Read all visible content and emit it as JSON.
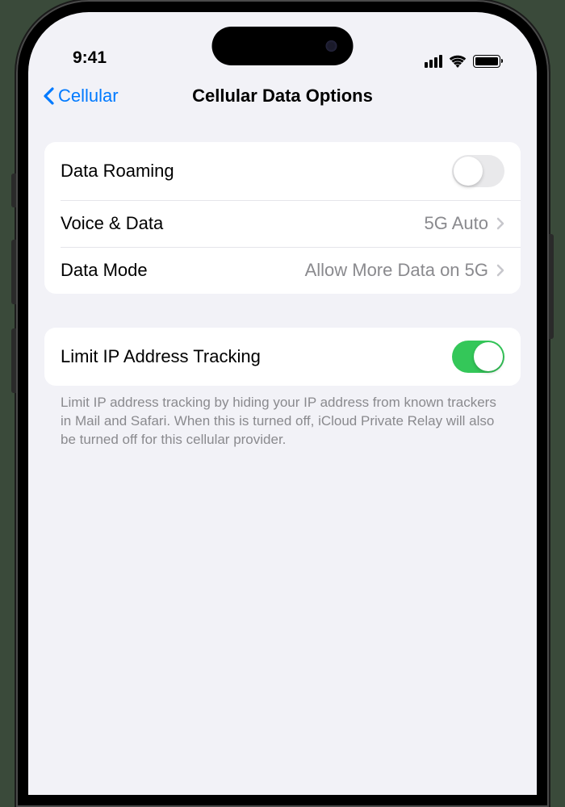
{
  "status_bar": {
    "time": "9:41"
  },
  "nav": {
    "back_label": "Cellular",
    "title": "Cellular Data Options"
  },
  "group1": {
    "data_roaming": {
      "label": "Data Roaming",
      "enabled": false
    },
    "voice_data": {
      "label": "Voice & Data",
      "value": "5G Auto"
    },
    "data_mode": {
      "label": "Data Mode",
      "value": "Allow More Data on 5G"
    }
  },
  "group2": {
    "limit_ip": {
      "label": "Limit IP Address Tracking",
      "enabled": true
    },
    "footer": "Limit IP address tracking by hiding your IP address from known trackers in Mail and Safari. When this is turned off, iCloud Private Relay will also be turned off for this cellular provider."
  }
}
